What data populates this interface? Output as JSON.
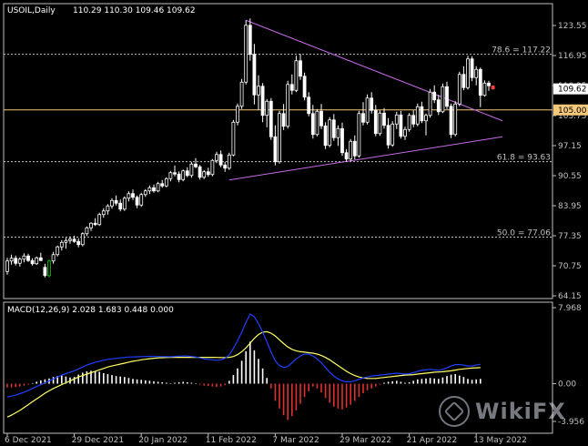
{
  "chart_data": {
    "type": "candlestick",
    "symbol": "USOIL,Daily",
    "ohlc_header": "110.29 110.30 109.46 109.62",
    "price_axis": {
      "ylim": [
        64.15,
        125.5
      ],
      "ticks": [
        123.55,
        116.95,
        110.35,
        103.75,
        97.15,
        90.55,
        83.95,
        77.35,
        70.75,
        64.15
      ],
      "current_price": 109.62
    },
    "x_labels": [
      {
        "index": 0,
        "label": "6 Dec 2021"
      },
      {
        "index": 16,
        "label": "29 Dec 2021"
      },
      {
        "index": 32,
        "label": "20 Jan 2022"
      },
      {
        "index": 48,
        "label": "11 Feb 2022"
      },
      {
        "index": 64,
        "label": "7 Mar 2022"
      },
      {
        "index": 80,
        "label": "29 Mar 2022"
      },
      {
        "index": 96,
        "label": "21 Apr 2022"
      },
      {
        "index": 112,
        "label": "13 May 2022"
      }
    ],
    "levels": [
      {
        "value": 117.22,
        "label": "78.6 = 117.22",
        "style": "dotted",
        "color": "#c0c0c0"
      },
      {
        "value": 105.0,
        "label": "105.00",
        "style": "solid",
        "color": "#f5c87a"
      },
      {
        "value": 93.63,
        "label": "61.8 = 93.63",
        "style": "dotted",
        "color": "#c0c0c0"
      },
      {
        "value": 77.06,
        "label": "50.0 = 77.06",
        "style": "dotted",
        "color": "#c0c0c0"
      }
    ],
    "trendlines": [
      {
        "from": [
          57,
          124.7
        ],
        "to": [
          117,
          102.6
        ],
        "color": "#c86be6"
      },
      {
        "from": [
          53,
          89.6
        ],
        "to": [
          117,
          99.1
        ],
        "color": "#c86be6"
      }
    ],
    "ohlc": [
      [
        69.5,
        72.5,
        68.8,
        71.8
      ],
      [
        71.8,
        73.2,
        71.0,
        72.4
      ],
      [
        72.4,
        73.0,
        70.8,
        71.3
      ],
      [
        71.3,
        72.6,
        70.6,
        72.2
      ],
      [
        72.2,
        73.5,
        71.5,
        72.9
      ],
      [
        72.9,
        73.4,
        71.6,
        71.9
      ],
      [
        71.9,
        72.4,
        70.8,
        71.2
      ],
      [
        71.2,
        72.8,
        70.9,
        72.5
      ],
      [
        72.5,
        73.6,
        71.8,
        71.9
      ],
      [
        70.4,
        71.2,
        68.2,
        68.6
      ],
      [
        68.6,
        72.1,
        68.2,
        71.8
      ],
      [
        71.8,
        73.8,
        71.2,
        73.2
      ],
      [
        73.2,
        75.2,
        72.8,
        74.9
      ],
      [
        74.9,
        76.4,
        74.1,
        75.9
      ],
      [
        75.9,
        76.9,
        74.5,
        76.3
      ],
      [
        76.3,
        77.2,
        75.6,
        76.6
      ],
      [
        76.6,
        77.4,
        75.8,
        76.1
      ],
      [
        76.1,
        76.8,
        74.8,
        75.4
      ],
      [
        75.4,
        78.1,
        75.0,
        77.8
      ],
      [
        77.8,
        79.4,
        77.3,
        79.1
      ],
      [
        79.1,
        80.3,
        78.4,
        80.1
      ],
      [
        80.1,
        81.2,
        79.5,
        79.8
      ],
      [
        79.8,
        82.4,
        79.5,
        82.0
      ],
      [
        82.0,
        83.4,
        81.3,
        82.8
      ],
      [
        82.8,
        84.3,
        82.0,
        83.9
      ],
      [
        83.9,
        85.6,
        83.3,
        85.1
      ],
      [
        85.1,
        86.2,
        84.0,
        84.5
      ],
      [
        84.5,
        85.3,
        82.7,
        83.2
      ],
      [
        83.2,
        86.0,
        82.8,
        85.6
      ],
      [
        85.6,
        87.1,
        84.9,
        86.6
      ],
      [
        86.6,
        87.5,
        85.2,
        85.8
      ],
      [
        85.8,
        86.2,
        83.4,
        84.1
      ],
      [
        84.1,
        86.8,
        83.7,
        86.4
      ],
      [
        86.4,
        87.6,
        85.9,
        87.2
      ],
      [
        87.2,
        88.4,
        86.5,
        87.9
      ],
      [
        87.9,
        88.6,
        86.8,
        87.2
      ],
      [
        87.2,
        89.2,
        86.9,
        88.8
      ],
      [
        88.8,
        89.6,
        87.9,
        88.3
      ],
      [
        88.3,
        90.2,
        88.0,
        89.9
      ],
      [
        89.9,
        91.6,
        89.3,
        91.2
      ],
      [
        91.2,
        92.8,
        90.4,
        90.9
      ],
      [
        90.9,
        91.5,
        89.1,
        89.7
      ],
      [
        89.7,
        91.9,
        89.3,
        91.6
      ],
      [
        91.6,
        92.4,
        90.2,
        90.6
      ],
      [
        90.6,
        93.6,
        90.1,
        93.1
      ],
      [
        93.1,
        94.4,
        92.2,
        92.5
      ],
      [
        92.5,
        92.9,
        89.7,
        90.2
      ],
      [
        90.2,
        91.8,
        89.8,
        91.4
      ],
      [
        91.4,
        92.3,
        90.3,
        90.8
      ],
      [
        90.8,
        94.2,
        90.4,
        93.9
      ],
      [
        93.9,
        95.8,
        93.3,
        95.2
      ],
      [
        95.2,
        96.1,
        92.4,
        92.9
      ],
      [
        92.9,
        93.6,
        91.4,
        92.2
      ],
      [
        92.2,
        95.6,
        91.8,
        95.1
      ],
      [
        95.1,
        102.8,
        94.8,
        102.3
      ],
      [
        102.3,
        106.4,
        101.6,
        105.8
      ],
      [
        105.8,
        111.8,
        105.2,
        111.1
      ],
      [
        111.1,
        124.7,
        110.6,
        123.6
      ],
      [
        123.6,
        125.1,
        115.8,
        117.2
      ],
      [
        117.2,
        119.5,
        106.2,
        108.3
      ],
      [
        108.3,
        112.6,
        105.0,
        110.2
      ],
      [
        110.2,
        110.9,
        102.3,
        103.8
      ],
      [
        103.8,
        107.4,
        101.2,
        106.9
      ],
      [
        106.9,
        107.6,
        98.4,
        99.1
      ],
      [
        99.1,
        101.6,
        92.8,
        93.6
      ],
      [
        93.6,
        104.8,
        93.2,
        104.2
      ],
      [
        104.2,
        106.3,
        100.6,
        101.4
      ],
      [
        101.4,
        111.4,
        100.9,
        110.6
      ],
      [
        110.6,
        112.8,
        108.4,
        109.3
      ],
      [
        109.3,
        116.9,
        108.9,
        115.8
      ],
      [
        115.8,
        117.3,
        111.6,
        112.4
      ],
      [
        112.4,
        113.2,
        107.1,
        107.8
      ],
      [
        107.8,
        108.9,
        103.6,
        104.2
      ],
      [
        104.2,
        106.1,
        98.7,
        99.6
      ],
      [
        99.6,
        105.2,
        99.2,
        104.7
      ],
      [
        104.7,
        106.3,
        100.8,
        101.5
      ],
      [
        101.5,
        102.3,
        96.4,
        97.2
      ],
      [
        97.2,
        103.4,
        96.8,
        102.8
      ],
      [
        102.8,
        104.1,
        98.2,
        98.9
      ],
      [
        98.9,
        101.6,
        97.1,
        100.9
      ],
      [
        100.9,
        102.2,
        94.9,
        95.6
      ],
      [
        95.6,
        96.4,
        93.6,
        94.2
      ],
      [
        94.2,
        98.6,
        93.8,
        98.1
      ],
      [
        98.1,
        99.4,
        94.1,
        94.9
      ],
      [
        94.9,
        104.8,
        94.5,
        104.2
      ],
      [
        104.2,
        106.7,
        101.6,
        102.3
      ],
      [
        102.3,
        108.4,
        101.8,
        107.6
      ],
      [
        107.6,
        108.9,
        104.2,
        104.9
      ],
      [
        104.9,
        106.1,
        99.2,
        99.8
      ],
      [
        99.8,
        104.9,
        99.3,
        104.3
      ],
      [
        104.3,
        105.4,
        100.9,
        101.6
      ],
      [
        101.6,
        103.2,
        96.5,
        97.3
      ],
      [
        97.3,
        102.5,
        96.9,
        101.9
      ],
      [
        101.9,
        104.6,
        100.8,
        103.9
      ],
      [
        103.9,
        104.8,
        98.7,
        99.2
      ],
      [
        99.2,
        101.3,
        98.4,
        100.7
      ],
      [
        100.7,
        104.3,
        100.2,
        103.8
      ],
      [
        103.8,
        104.9,
        101.2,
        101.9
      ],
      [
        101.9,
        106.4,
        101.4,
        105.7
      ],
      [
        105.7,
        106.8,
        102.1,
        102.6
      ],
      [
        102.6,
        104.2,
        99.4,
        103.8
      ],
      [
        103.8,
        109.6,
        103.3,
        108.9
      ],
      [
        108.9,
        110.4,
        106.5,
        107.2
      ],
      [
        107.2,
        108.3,
        103.9,
        104.6
      ],
      [
        104.6,
        110.8,
        104.3,
        110.1
      ],
      [
        110.1,
        111.2,
        105.2,
        105.8
      ],
      [
        105.8,
        106.4,
        98.8,
        99.6
      ],
      [
        99.6,
        106.9,
        99.2,
        106.3
      ],
      [
        106.3,
        113.4,
        105.8,
        112.8
      ],
      [
        112.8,
        114.6,
        109.3,
        109.9
      ],
      [
        109.9,
        116.9,
        109.5,
        116.2
      ],
      [
        116.2,
        116.8,
        111.3,
        112.1
      ],
      [
        112.1,
        114.6,
        110.4,
        113.9
      ],
      [
        113.9,
        114.3,
        105.6,
        108.2
      ],
      [
        108.2,
        111.5,
        107.9,
        110.9
      ],
      [
        110.9,
        111.4,
        109.2,
        110.3
      ],
      [
        110.29,
        110.3,
        109.46,
        109.62
      ]
    ],
    "macd": {
      "label": "MACD(12,26,9) 2.028 1.683 0.448 0.000",
      "ylim": [
        -3.956,
        7.968
      ],
      "ticks": [
        7.968,
        0.0,
        -3.956
      ],
      "histogram": [
        -0.4,
        -0.4,
        -0.35,
        -0.3,
        -0.2,
        -0.1,
        0.05,
        0.2,
        0.35,
        0.45,
        0.55,
        0.7,
        0.8,
        0.85,
        0.75,
        0.65,
        0.7,
        0.95,
        1.15,
        1.3,
        1.35,
        1.3,
        1.25,
        1.1,
        1.0,
        0.9,
        0.8,
        0.75,
        0.7,
        0.6,
        0.5,
        0.45,
        0.4,
        0.35,
        0.3,
        0.25,
        0.2,
        0.15,
        0.1,
        0.05,
        0.1,
        0.15,
        0.2,
        0.15,
        0.1,
        0.05,
        -0.1,
        -0.2,
        -0.25,
        -0.3,
        -0.35,
        -0.3,
        -0.15,
        0.3,
        0.9,
        1.6,
        2.4,
        3.4,
        4.4,
        3.5,
        2.6,
        1.6,
        0.6,
        -0.5,
        -1.8,
        -2.6,
        -3.3,
        -3.8,
        -3.4,
        -2.8,
        -2.1,
        -1.4,
        -0.8,
        -0.3,
        -0.5,
        -0.9,
        -1.5,
        -2.0,
        -2.4,
        -2.6,
        -2.7,
        -2.5,
        -2.2,
        -1.8,
        -1.4,
        -1.0,
        -0.7,
        -0.5,
        -0.3,
        -0.1,
        0.1,
        0.2,
        0.25,
        0.3,
        0.2,
        0.1,
        0.15,
        0.3,
        0.45,
        0.5,
        0.55,
        0.6,
        0.55,
        0.5,
        0.65,
        0.8,
        0.95,
        1.0,
        0.85,
        0.7,
        0.5,
        0.4,
        0.45,
        0.5
      ],
      "macd_line": [
        -1.4,
        -1.3,
        -1.2,
        -1.05,
        -0.9,
        -0.7,
        -0.5,
        -0.3,
        -0.1,
        0.1,
        0.3,
        0.5,
        0.7,
        0.9,
        1.05,
        1.2,
        1.35,
        1.55,
        1.75,
        1.95,
        2.1,
        2.25,
        2.35,
        2.45,
        2.55,
        2.6,
        2.65,
        2.7,
        2.75,
        2.8,
        2.8,
        2.82,
        2.84,
        2.85,
        2.86,
        2.86,
        2.85,
        2.84,
        2.83,
        2.82,
        2.85,
        2.88,
        2.9,
        2.9,
        2.85,
        2.8,
        2.7,
        2.6,
        2.55,
        2.5,
        2.45,
        2.5,
        2.65,
        3.0,
        3.7,
        4.5,
        5.4,
        6.4,
        7.3,
        7.0,
        6.3,
        5.4,
        4.4,
        3.3,
        2.4,
        1.9,
        1.7,
        1.8,
        2.2,
        2.6,
        2.9,
        3.1,
        3.1,
        2.9,
        2.6,
        2.2,
        1.7,
        1.2,
        0.8,
        0.5,
        0.3,
        0.2,
        0.2,
        0.3,
        0.45,
        0.6,
        0.7,
        0.8,
        0.85,
        0.9,
        0.95,
        1.0,
        1.05,
        1.1,
        1.05,
        1.0,
        1.05,
        1.15,
        1.3,
        1.4,
        1.45,
        1.5,
        1.45,
        1.4,
        1.5,
        1.65,
        1.85,
        2.0,
        2.0,
        1.95,
        1.85,
        1.85,
        1.95,
        2.03
      ],
      "signal_line": [
        -3.5,
        -3.3,
        -3.05,
        -2.8,
        -2.5,
        -2.2,
        -1.9,
        -1.6,
        -1.3,
        -1.0,
        -0.75,
        -0.5,
        -0.3,
        -0.1,
        0.1,
        0.3,
        0.5,
        0.7,
        0.85,
        1.0,
        1.15,
        1.3,
        1.45,
        1.6,
        1.75,
        1.85,
        1.95,
        2.05,
        2.15,
        2.25,
        2.35,
        2.42,
        2.5,
        2.56,
        2.62,
        2.66,
        2.7,
        2.72,
        2.74,
        2.76,
        2.76,
        2.76,
        2.76,
        2.76,
        2.76,
        2.76,
        2.76,
        2.76,
        2.76,
        2.76,
        2.75,
        2.74,
        2.74,
        2.76,
        2.85,
        3.05,
        3.35,
        3.75,
        4.25,
        4.75,
        5.15,
        5.4,
        5.45,
        5.3,
        5.0,
        4.6,
        4.2,
        3.85,
        3.6,
        3.45,
        3.35,
        3.3,
        3.25,
        3.2,
        3.1,
        2.95,
        2.75,
        2.5,
        2.2,
        1.9,
        1.6,
        1.3,
        1.05,
        0.85,
        0.7,
        0.6,
        0.55,
        0.55,
        0.55,
        0.6,
        0.65,
        0.7,
        0.75,
        0.8,
        0.85,
        0.9,
        0.92,
        0.95,
        1.0,
        1.05,
        1.1,
        1.15,
        1.2,
        1.22,
        1.25,
        1.3,
        1.35,
        1.42,
        1.5,
        1.55,
        1.6,
        1.63,
        1.66,
        1.68
      ]
    },
    "colors": {
      "background": "#000000",
      "axis": "#c0c0c0",
      "candle": "#ffffff",
      "last_candle": "#ff4040",
      "first_bull": "#00c800",
      "macd_line": "#1f3fff",
      "signal_line": "#ffff66",
      "hist_positive": "#ffffff",
      "hist_negative": "#e03030",
      "price_tag_bg": "#ffffff",
      "price_tag_text": "#000000",
      "level_tag_bg": "#f5c87a"
    },
    "watermark": "WikiFX"
  }
}
